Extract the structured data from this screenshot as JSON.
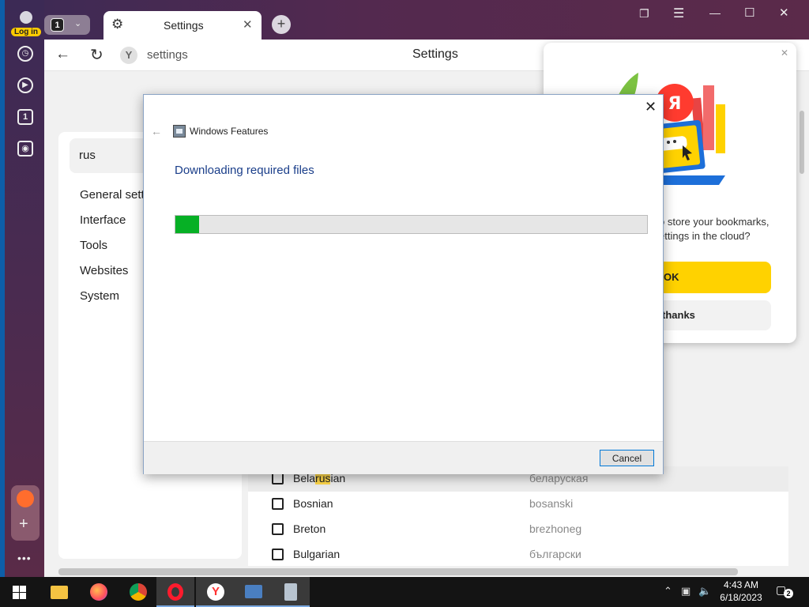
{
  "browser": {
    "login_label": "Log in",
    "tab_count": "1",
    "tab": {
      "title": "Settings",
      "icon": "gear-icon"
    },
    "address": {
      "url": "settings",
      "page_title": "Settings"
    }
  },
  "settings": {
    "search_value": "rus",
    "nav": [
      "General setti",
      "Interface",
      "Tools",
      "Websites",
      "System"
    ],
    "languages": [
      {
        "name_pre": "Bela",
        "name_match": "rus",
        "name_post": "ian",
        "native": "беларуская",
        "checked": false,
        "highlighted": true
      },
      {
        "name_pre": "Bosnian",
        "name_match": "",
        "name_post": "",
        "native": "bosanski",
        "checked": false,
        "highlighted": false
      },
      {
        "name_pre": "Breton",
        "name_match": "",
        "name_post": "",
        "native": "brezhoneg",
        "checked": false,
        "highlighted": false
      },
      {
        "name_pre": "Bulgarian",
        "name_match": "",
        "name_post": "",
        "native": "български",
        "checked": false,
        "highlighted": false
      }
    ]
  },
  "cloud_popup": {
    "text_line1": "o store your bookmarks,",
    "text_line2": "ettings in the cloud?",
    "ok_label": "OK",
    "no_label": "thanks",
    "colors": {
      "ok_button": "#ffd200"
    }
  },
  "dialog": {
    "window_title": "Windows Features",
    "heading": "Downloading required files",
    "progress_fraction": 0.05,
    "cancel_label": "Cancel",
    "colors": {
      "progress": "#06b025",
      "heading": "#1a3e8a"
    }
  },
  "taskbar": {
    "apps": [
      "start-icon",
      "file-explorer-icon",
      "firefox-icon",
      "chrome-icon",
      "opera-icon",
      "yandex-browser-icon",
      "remote-desktop-icon",
      "windows-features-icon"
    ],
    "time": "4:43 AM",
    "date": "6/18/2023",
    "notification_count": "2"
  }
}
